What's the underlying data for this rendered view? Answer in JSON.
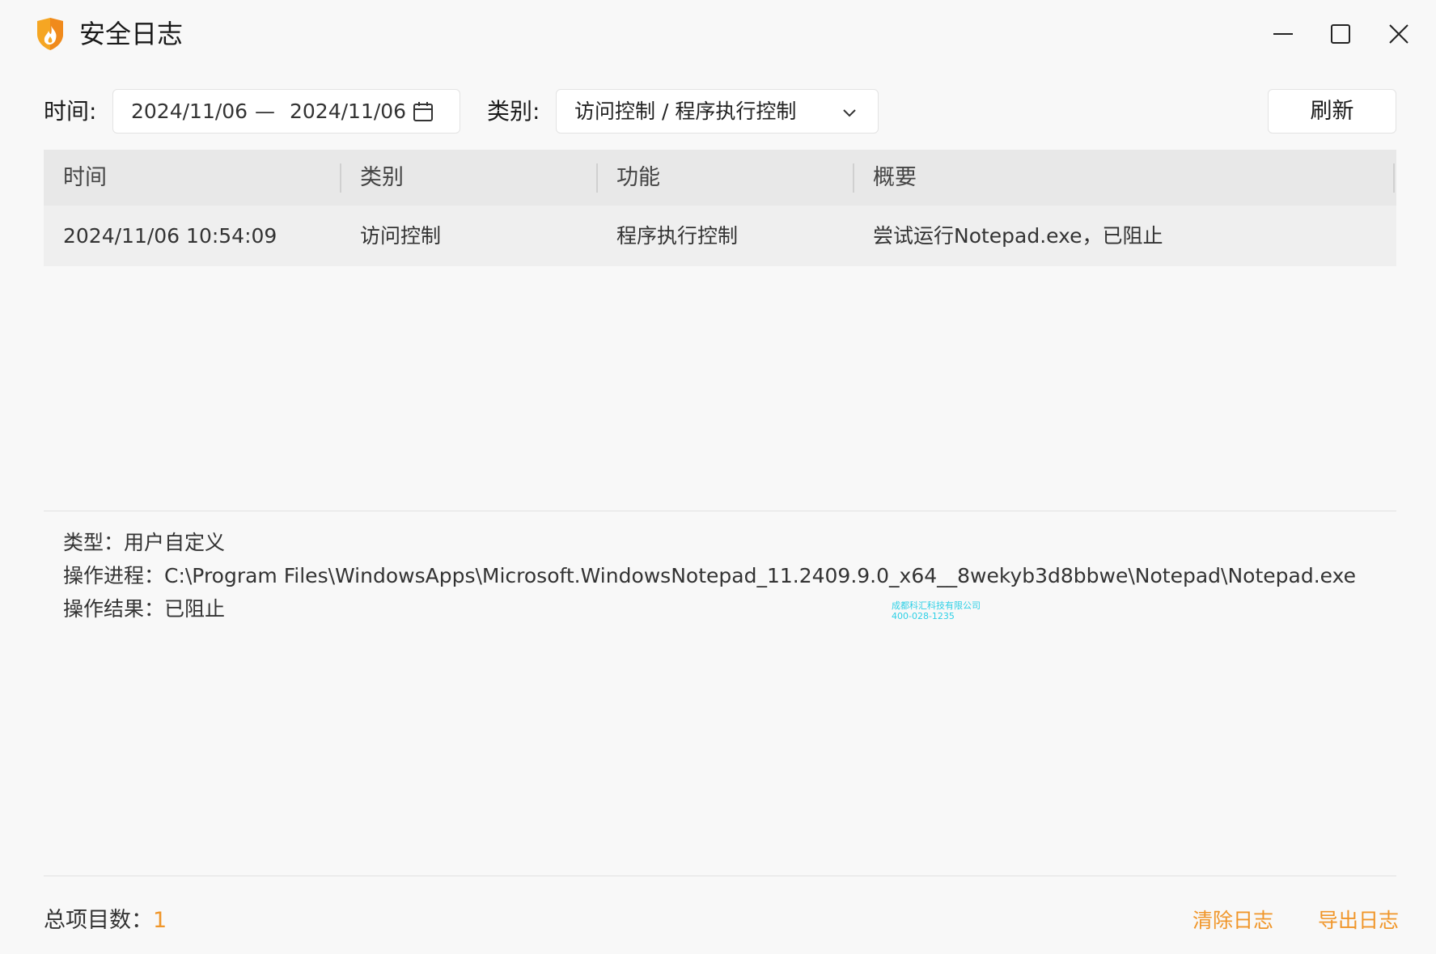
{
  "window": {
    "title": "安全日志"
  },
  "filters": {
    "time_label": "时间:",
    "date_start": "2024/11/06",
    "date_separator": "—",
    "date_end": "2024/11/06",
    "category_label": "类别:",
    "category_value": "访问控制 / 程序执行控制",
    "refresh_label": "刷新"
  },
  "table": {
    "columns": [
      "时间",
      "类别",
      "功能",
      "概要"
    ],
    "rows": [
      [
        "2024/11/06 10:54:09",
        "访问控制",
        "程序执行控制",
        "尝试运行Notepad.exe，已阻止"
      ]
    ]
  },
  "details": {
    "type_line": "类型：用户自定义",
    "process_line": "操作进程：C:\\Program Files\\WindowsApps\\Microsoft.WindowsNotepad_11.2409.9.0_x64__8wekyb3d8bbwe\\Notepad\\Notepad.exe",
    "result_line": "操作结果：已阻止"
  },
  "watermark": {
    "company": "成都科汇科技有限公司",
    "phone": "400-028-1235"
  },
  "footer": {
    "total_label": "总项目数：",
    "total_count": "1",
    "clear_label": "清除日志",
    "export_label": "导出日志"
  },
  "colors": {
    "accent": "#f0962a",
    "header_bg": "#e8e8e8",
    "row_bg": "#efefef",
    "window_bg": "#f8f8f8"
  }
}
